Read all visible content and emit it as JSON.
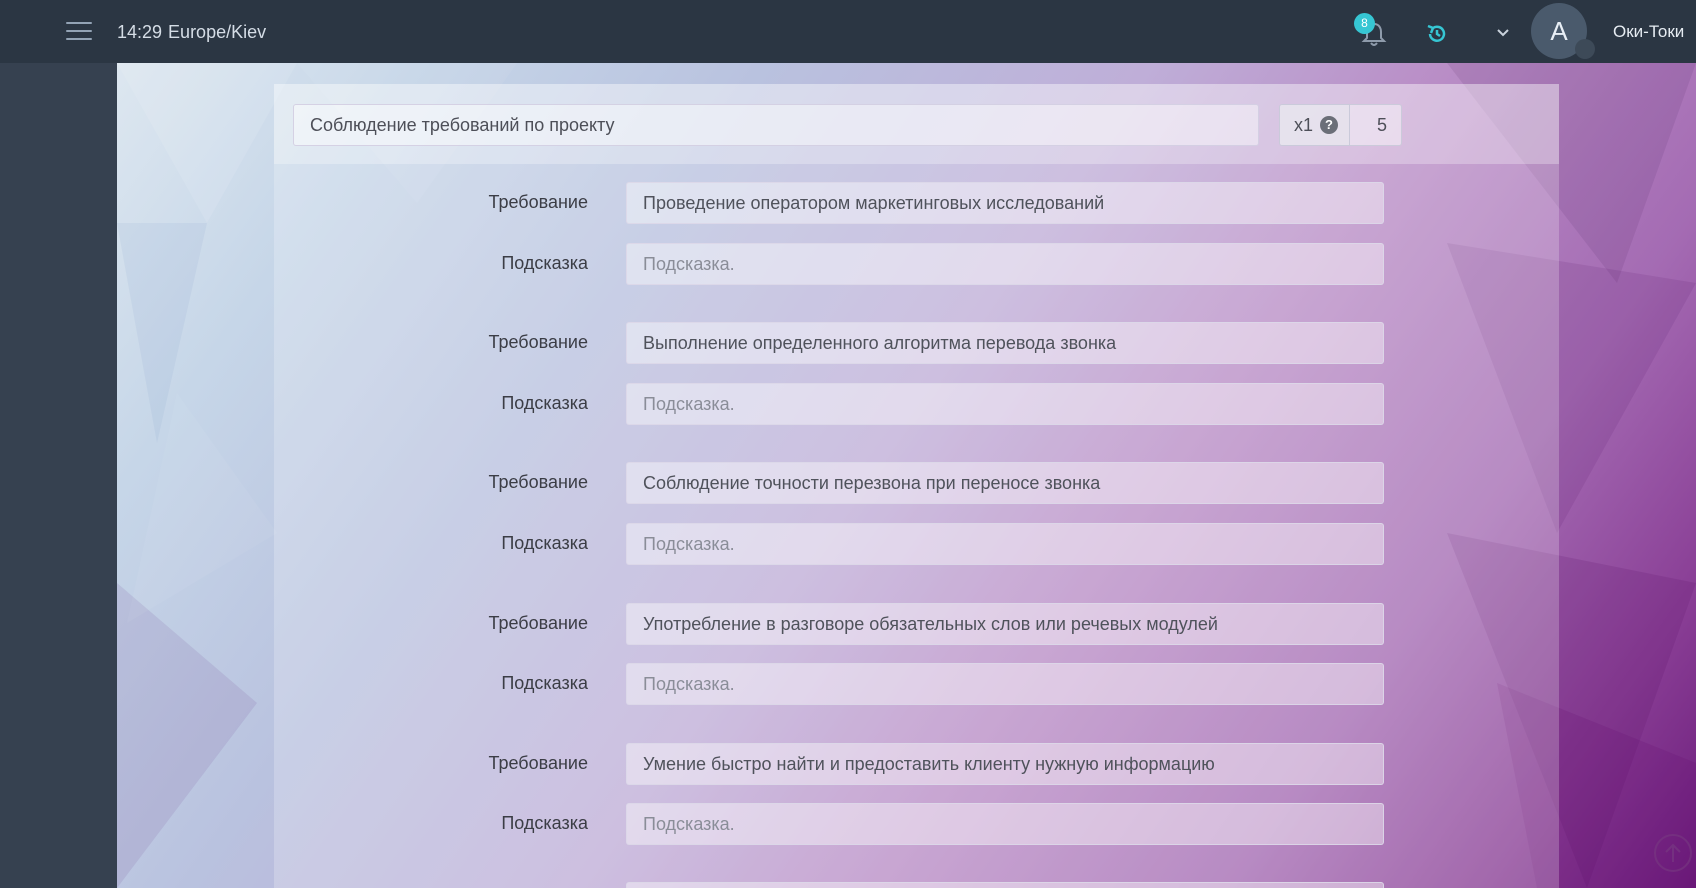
{
  "header": {
    "time": "14:29",
    "timezone": "Europe/Kiev",
    "notifications_count": "8",
    "avatar_letter": "A",
    "username": "Оки-Токи",
    "icons": [
      "menu-icon",
      "bell-icon",
      "history-icon",
      "chevron-down-icon"
    ],
    "accent_color": "#36c6d3"
  },
  "form": {
    "group_title": "Соблюдение требований по проекту",
    "multiplier": "x1",
    "help_icon": "?",
    "weight": "5",
    "requirement_label": "Требование",
    "hint_label": "Подсказка",
    "hint_placeholder": "Подсказка.",
    "items": [
      {
        "requirement": "Проведение оператором маркетинговых исследований",
        "hint": ""
      },
      {
        "requirement": "Выполнение определенного алгоритма перевода звонка",
        "hint": ""
      },
      {
        "requirement": "Соблюдение точности перезвона при переносе звонка",
        "hint": ""
      },
      {
        "requirement": "Употребление в разговоре обязательных слов или речевых модулей",
        "hint": ""
      },
      {
        "requirement": "Умение быстро найти и предоставить клиенту нужную информацию",
        "hint": ""
      }
    ]
  }
}
